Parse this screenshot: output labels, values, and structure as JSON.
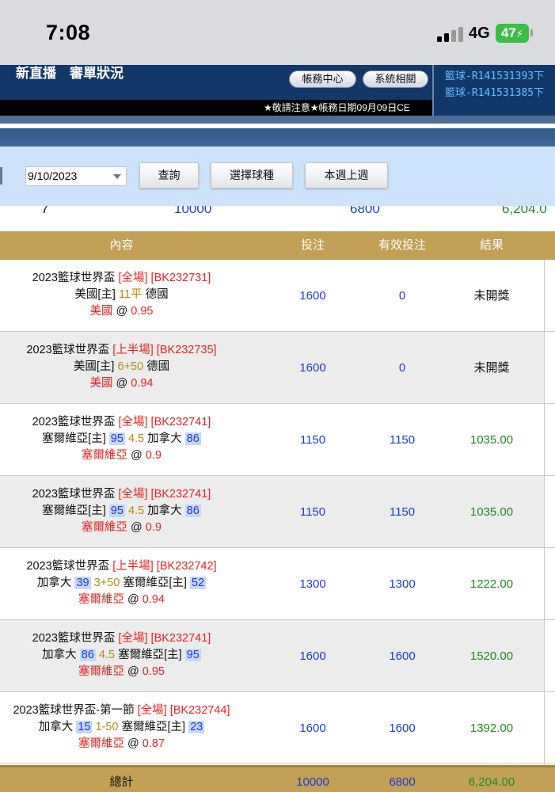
{
  "status_bar": {
    "time": "7:08",
    "network": "4G",
    "battery": "47"
  },
  "header": {
    "title": "新直播　審單狀況",
    "account_center_label": "帳務中心",
    "system_label": "系統相關",
    "notice_text": "★敬請注意★帳務日期09月09日CE",
    "side_messages": [
      "籃球-R141531393下",
      "籃球-R141531385下"
    ]
  },
  "filter": {
    "date_value": "9/10/2023",
    "query_label": "查詢",
    "select_sport_label": "選擇球種",
    "week_label": "本週上週"
  },
  "partial_summary": {
    "count": "7",
    "bet": "10000",
    "valid": "6800",
    "result": "6,204.0"
  },
  "table": {
    "columns": [
      "內容",
      "投注",
      "有效投注",
      "結果"
    ],
    "rows": [
      {
        "league": "2023籃球世界盃",
        "period": "[全場]",
        "code": "[BK232731]",
        "team1": "美國[主]",
        "score1": "",
        "line": "11平",
        "team2": "德國",
        "score2": "",
        "pick": "美國",
        "odds": "0.95",
        "bet": "1600",
        "valid": "0",
        "result": "未開獎",
        "pending": true
      },
      {
        "league": "2023籃球世界盃",
        "period": "[上半場]",
        "code": "[BK232735]",
        "team1": "美國[主]",
        "score1": "",
        "line": "6+50",
        "team2": "德國",
        "score2": "",
        "pick": "美國",
        "odds": "0.94",
        "bet": "1600",
        "valid": "0",
        "result": "未開獎",
        "pending": true
      },
      {
        "league": "2023籃球世界盃",
        "period": "[全場]",
        "code": "[BK232741]",
        "team1": "塞爾維亞[主]",
        "score1": "95",
        "line": "4.5",
        "team2": "加拿大",
        "score2": "86",
        "pick": "塞爾維亞",
        "odds": "0.9",
        "bet": "1150",
        "valid": "1150",
        "result": "1035.00",
        "pending": false
      },
      {
        "league": "2023籃球世界盃",
        "period": "[全場]",
        "code": "[BK232741]",
        "team1": "塞爾維亞[主]",
        "score1": "95",
        "line": "4.5",
        "team2": "加拿大",
        "score2": "86",
        "pick": "塞爾維亞",
        "odds": "0.9",
        "bet": "1150",
        "valid": "1150",
        "result": "1035.00",
        "pending": false
      },
      {
        "league": "2023籃球世界盃",
        "period": "[上半場]",
        "code": "[BK232742]",
        "team1": "加拿大",
        "score1": "39",
        "line": "3+50",
        "team2": "塞爾維亞[主]",
        "score2": "52",
        "pick": "塞爾維亞",
        "odds": "0.94",
        "bet": "1300",
        "valid": "1300",
        "result": "1222.00",
        "pending": false
      },
      {
        "league": "2023籃球世界盃",
        "period": "[全場]",
        "code": "[BK232741]",
        "team1": "加拿大",
        "score1": "86",
        "line": "4.5",
        "team2": "塞爾維亞[主]",
        "score2": "95",
        "pick": "塞爾維亞",
        "odds": "0.95",
        "bet": "1600",
        "valid": "1600",
        "result": "1520.00",
        "pending": false
      },
      {
        "league": "2023籃球世界盃-第一節",
        "period": "[全場]",
        "code": "[BK232744]",
        "team1": "加拿大",
        "score1": "15",
        "line": "1-50",
        "team2": "塞爾維亞[主]",
        "score2": "23",
        "pick": "塞爾維亞",
        "odds": "0.87",
        "bet": "1600",
        "valid": "1600",
        "result": "1392.00",
        "pending": false
      }
    ],
    "total": {
      "label": "總計",
      "bet": "10000",
      "valid": "6800",
      "result": "6,204.00"
    }
  },
  "colors": {
    "navy": "#12386a",
    "gold": "#c2a055",
    "blue_text": "#1a3cd6",
    "red_text": "#e42323",
    "green_text": "#1f8a1f"
  }
}
